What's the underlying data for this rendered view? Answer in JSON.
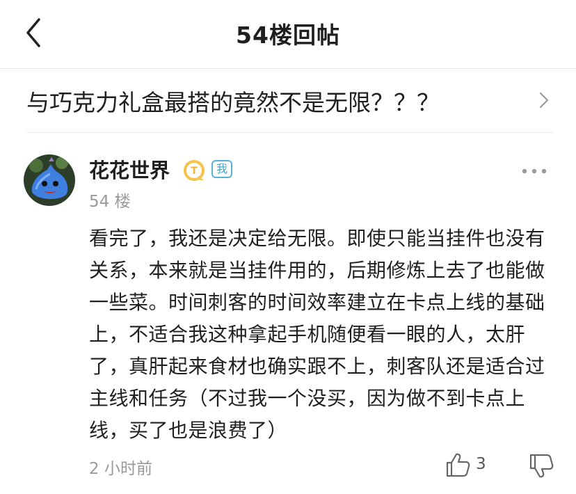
{
  "header": {
    "title": "54楼回帖",
    "back_icon": "chevron-left-icon"
  },
  "thread": {
    "title": "与巧克力礼盒最搭的竟然不是无限？？？",
    "chevron_icon": "chevron-right-icon"
  },
  "post": {
    "username": "花花世界",
    "level_badge_icon": "level-t-badge-icon",
    "me_badge": "我",
    "floor": "54 楼",
    "content": "看完了，我还是决定给无限。即使只能当挂件也没有关系，本来就是当挂件用的，后期修炼上去了也能做一些菜。时间刺客的时间效率建立在卡点上线的基础上，不适合我这种拿起手机随便看一眼的人，太肝了，真肝起来食材也确实跟不上，刺客队还是适合过主线和任务（不过我一个没买，因为做不到卡点上线，买了也是浪费了）",
    "time": "2 小时前",
    "like_count": "3",
    "more_icon": "more-dots-icon",
    "like_icon": "thumbs-up-icon",
    "dislike_icon": "thumbs-down-icon"
  },
  "colors": {
    "text": "#1f1f1f",
    "secondary_text": "#999999",
    "badge_gold": "#f3b53a",
    "badge_blue": "#3ea3cf"
  }
}
